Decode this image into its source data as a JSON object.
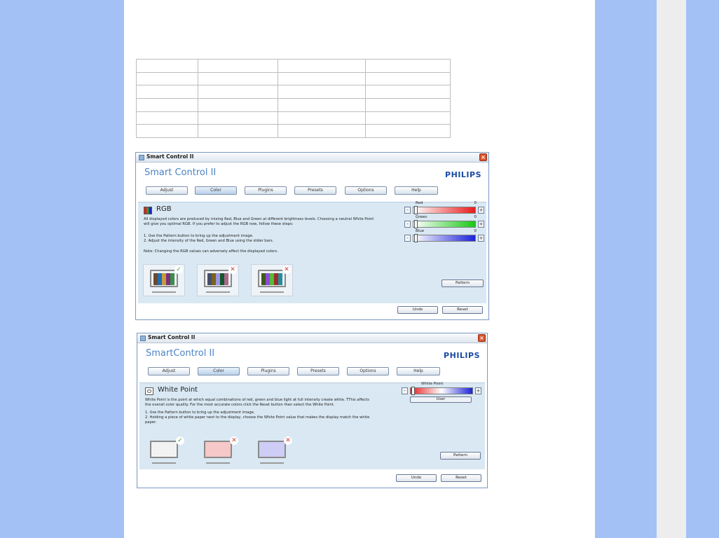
{
  "colors": {
    "band_blue": "#a3c1f5",
    "band_grey": "#ededed",
    "philips_blue": "#1b4ba3",
    "title_blue": "#4d83c5",
    "panel_bg": "#d9e8f3"
  },
  "windows": [
    {
      "window_title": "Smart Control II",
      "app_title": "Smart Control II",
      "brand": "PHILIPS",
      "tabs": [
        "Adjust",
        "Color",
        "Plugins",
        "Presets",
        "Options",
        "Help"
      ],
      "active_tab": "Color",
      "section_icon": "rgb-bars-icon",
      "section_title": "RGB",
      "description": "All displayed colors are produced by mixing Red, Blue and Green at different brightness levels. Choosing a neutral White Point will give you optimal RGB. If you prefer to adjust the RGB now, follow these steps:",
      "steps": [
        "1. Use the Pattern button to bring up the adjustment image.",
        "2. Adjust the intensity of the Red, Green and Blue using the slider bars."
      ],
      "note": "Note: Changing the RGB values can adversely affect the displayed colors.",
      "sliders": [
        {
          "label": "Red",
          "value": "0",
          "color": "#e81c1c"
        },
        {
          "label": "Green",
          "value": "0",
          "color": "#18c818"
        },
        {
          "label": "Blue",
          "value": "0",
          "color": "#1c22d8"
        }
      ],
      "minus": "-",
      "plus": "+",
      "pattern_button": "Pattern",
      "undo_button": "Undo",
      "reset_button": "Reset",
      "previews": [
        {
          "status": "correct",
          "mark": "✓"
        },
        {
          "status": "incorrect",
          "mark": "✕"
        },
        {
          "status": "incorrect",
          "mark": "✕"
        }
      ]
    },
    {
      "window_title": "Smart Control II",
      "app_title": "SmartControl II",
      "brand": "PHILIPS",
      "tabs": [
        "Adjust",
        "Color",
        "Plugins",
        "Presets",
        "Options",
        "Help"
      ],
      "active_tab": "Color",
      "section_icon": "white-point-icon",
      "section_title": "White Point",
      "description": "White Point is the point at which equal combinations of red, green and blue light at full intensity create white. TThis affects the overall color quality. For the most accurate colors click the Reset button then select the White Point.",
      "steps": [
        "1. Use the Pattern button to bring up the adjustment image.",
        "2. Holding a piece of white paper next to the display, choose the White Point value that makes the display match the white paper."
      ],
      "slider_label": "White Point",
      "slider_value_label": "User",
      "minus": "-",
      "plus": "+",
      "pattern_button": "Pattern",
      "undo_button": "Undo",
      "reset_button": "Reset",
      "previews": [
        {
          "status": "correct",
          "mark": "✓",
          "tint": "#f2f2f2"
        },
        {
          "status": "incorrect",
          "mark": "✕",
          "tint": "#f6c8c8"
        },
        {
          "status": "incorrect",
          "mark": "✕",
          "tint": "#cdcdf6"
        }
      ]
    }
  ]
}
